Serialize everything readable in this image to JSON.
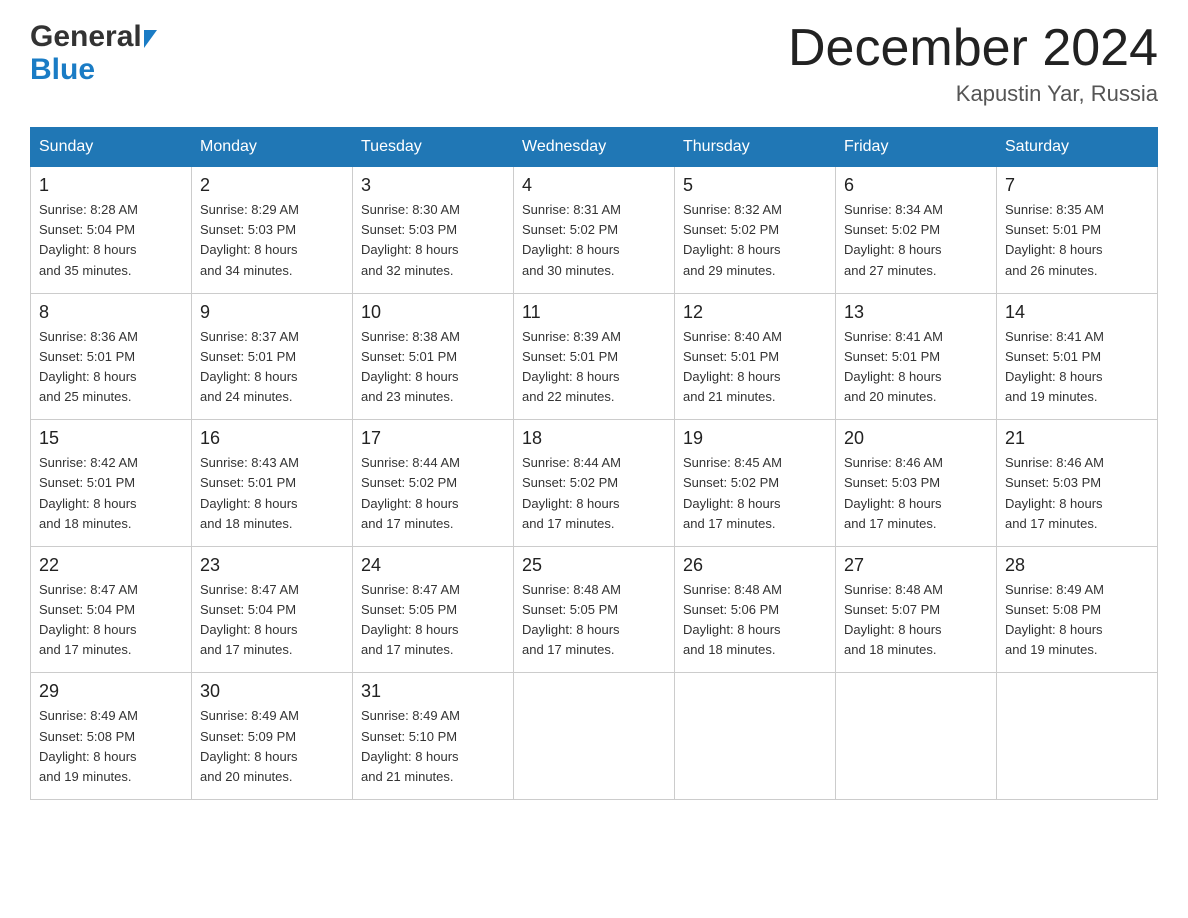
{
  "header": {
    "logo": {
      "line1": "General",
      "line2": "Blue"
    },
    "title": "December 2024",
    "location": "Kapustin Yar, Russia"
  },
  "weekdays": [
    "Sunday",
    "Monday",
    "Tuesday",
    "Wednesday",
    "Thursday",
    "Friday",
    "Saturday"
  ],
  "weeks": [
    [
      {
        "day": "1",
        "sunrise": "8:28 AM",
        "sunset": "5:04 PM",
        "daylight": "8 hours and 35 minutes."
      },
      {
        "day": "2",
        "sunrise": "8:29 AM",
        "sunset": "5:03 PM",
        "daylight": "8 hours and 34 minutes."
      },
      {
        "day": "3",
        "sunrise": "8:30 AM",
        "sunset": "5:03 PM",
        "daylight": "8 hours and 32 minutes."
      },
      {
        "day": "4",
        "sunrise": "8:31 AM",
        "sunset": "5:02 PM",
        "daylight": "8 hours and 30 minutes."
      },
      {
        "day": "5",
        "sunrise": "8:32 AM",
        "sunset": "5:02 PM",
        "daylight": "8 hours and 29 minutes."
      },
      {
        "day": "6",
        "sunrise": "8:34 AM",
        "sunset": "5:02 PM",
        "daylight": "8 hours and 27 minutes."
      },
      {
        "day": "7",
        "sunrise": "8:35 AM",
        "sunset": "5:01 PM",
        "daylight": "8 hours and 26 minutes."
      }
    ],
    [
      {
        "day": "8",
        "sunrise": "8:36 AM",
        "sunset": "5:01 PM",
        "daylight": "8 hours and 25 minutes."
      },
      {
        "day": "9",
        "sunrise": "8:37 AM",
        "sunset": "5:01 PM",
        "daylight": "8 hours and 24 minutes."
      },
      {
        "day": "10",
        "sunrise": "8:38 AM",
        "sunset": "5:01 PM",
        "daylight": "8 hours and 23 minutes."
      },
      {
        "day": "11",
        "sunrise": "8:39 AM",
        "sunset": "5:01 PM",
        "daylight": "8 hours and 22 minutes."
      },
      {
        "day": "12",
        "sunrise": "8:40 AM",
        "sunset": "5:01 PM",
        "daylight": "8 hours and 21 minutes."
      },
      {
        "day": "13",
        "sunrise": "8:41 AM",
        "sunset": "5:01 PM",
        "daylight": "8 hours and 20 minutes."
      },
      {
        "day": "14",
        "sunrise": "8:41 AM",
        "sunset": "5:01 PM",
        "daylight": "8 hours and 19 minutes."
      }
    ],
    [
      {
        "day": "15",
        "sunrise": "8:42 AM",
        "sunset": "5:01 PM",
        "daylight": "8 hours and 18 minutes."
      },
      {
        "day": "16",
        "sunrise": "8:43 AM",
        "sunset": "5:01 PM",
        "daylight": "8 hours and 18 minutes."
      },
      {
        "day": "17",
        "sunrise": "8:44 AM",
        "sunset": "5:02 PM",
        "daylight": "8 hours and 17 minutes."
      },
      {
        "day": "18",
        "sunrise": "8:44 AM",
        "sunset": "5:02 PM",
        "daylight": "8 hours and 17 minutes."
      },
      {
        "day": "19",
        "sunrise": "8:45 AM",
        "sunset": "5:02 PM",
        "daylight": "8 hours and 17 minutes."
      },
      {
        "day": "20",
        "sunrise": "8:46 AM",
        "sunset": "5:03 PM",
        "daylight": "8 hours and 17 minutes."
      },
      {
        "day": "21",
        "sunrise": "8:46 AM",
        "sunset": "5:03 PM",
        "daylight": "8 hours and 17 minutes."
      }
    ],
    [
      {
        "day": "22",
        "sunrise": "8:47 AM",
        "sunset": "5:04 PM",
        "daylight": "8 hours and 17 minutes."
      },
      {
        "day": "23",
        "sunrise": "8:47 AM",
        "sunset": "5:04 PM",
        "daylight": "8 hours and 17 minutes."
      },
      {
        "day": "24",
        "sunrise": "8:47 AM",
        "sunset": "5:05 PM",
        "daylight": "8 hours and 17 minutes."
      },
      {
        "day": "25",
        "sunrise": "8:48 AM",
        "sunset": "5:05 PM",
        "daylight": "8 hours and 17 minutes."
      },
      {
        "day": "26",
        "sunrise": "8:48 AM",
        "sunset": "5:06 PM",
        "daylight": "8 hours and 18 minutes."
      },
      {
        "day": "27",
        "sunrise": "8:48 AM",
        "sunset": "5:07 PM",
        "daylight": "8 hours and 18 minutes."
      },
      {
        "day": "28",
        "sunrise": "8:49 AM",
        "sunset": "5:08 PM",
        "daylight": "8 hours and 19 minutes."
      }
    ],
    [
      {
        "day": "29",
        "sunrise": "8:49 AM",
        "sunset": "5:08 PM",
        "daylight": "8 hours and 19 minutes."
      },
      {
        "day": "30",
        "sunrise": "8:49 AM",
        "sunset": "5:09 PM",
        "daylight": "8 hours and 20 minutes."
      },
      {
        "day": "31",
        "sunrise": "8:49 AM",
        "sunset": "5:10 PM",
        "daylight": "8 hours and 21 minutes."
      },
      null,
      null,
      null,
      null
    ]
  ],
  "labels": {
    "sunrise": "Sunrise:",
    "sunset": "Sunset:",
    "daylight": "Daylight:"
  }
}
